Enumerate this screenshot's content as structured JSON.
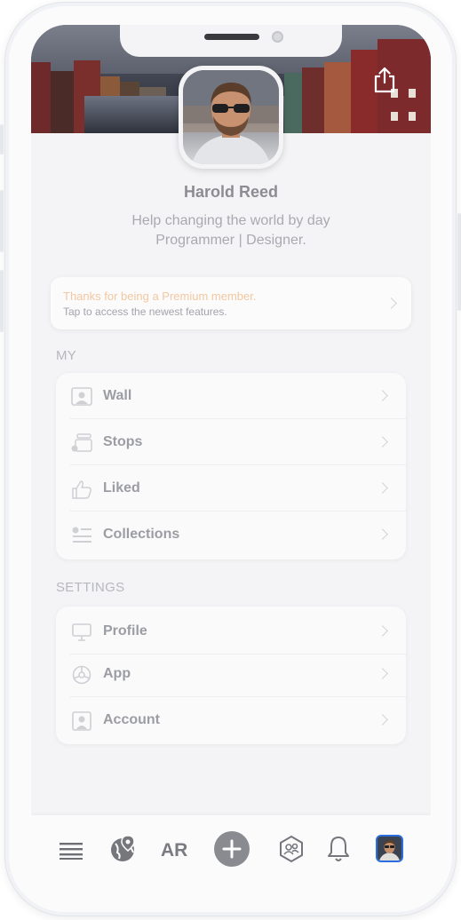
{
  "profile": {
    "name": "Harold Reed",
    "bio_line1": "Help changing the world by day",
    "bio_line2": "Programmer | Designer."
  },
  "premium": {
    "title": "Thanks for being a Premium member.",
    "subtitle": "Tap to access the newest features."
  },
  "my_section": {
    "label": "MY",
    "items": [
      {
        "label": "Wall",
        "icon": "wall-icon"
      },
      {
        "label": "Stops",
        "icon": "stops-icon"
      },
      {
        "label": "Liked",
        "icon": "thumbs-up-icon"
      },
      {
        "label": "Collections",
        "icon": "collections-icon"
      }
    ]
  },
  "settings_section": {
    "label": "SETTINGS",
    "items": [
      {
        "label": "Profile",
        "icon": "monitor-icon"
      },
      {
        "label": "App",
        "icon": "app-gear-icon"
      },
      {
        "label": "Account",
        "icon": "account-icon"
      }
    ]
  },
  "tabbar": {
    "ar_label": "AR",
    "items": [
      "menu-icon",
      "globe-pin-icon",
      "ar-tab",
      "add-button",
      "community-icon",
      "bell-icon",
      "profile-avatar"
    ]
  },
  "colors": {
    "premium_title": "#f3c79f",
    "text_muted": "#9c9da3",
    "accent_blue": "#2a6ee0"
  }
}
